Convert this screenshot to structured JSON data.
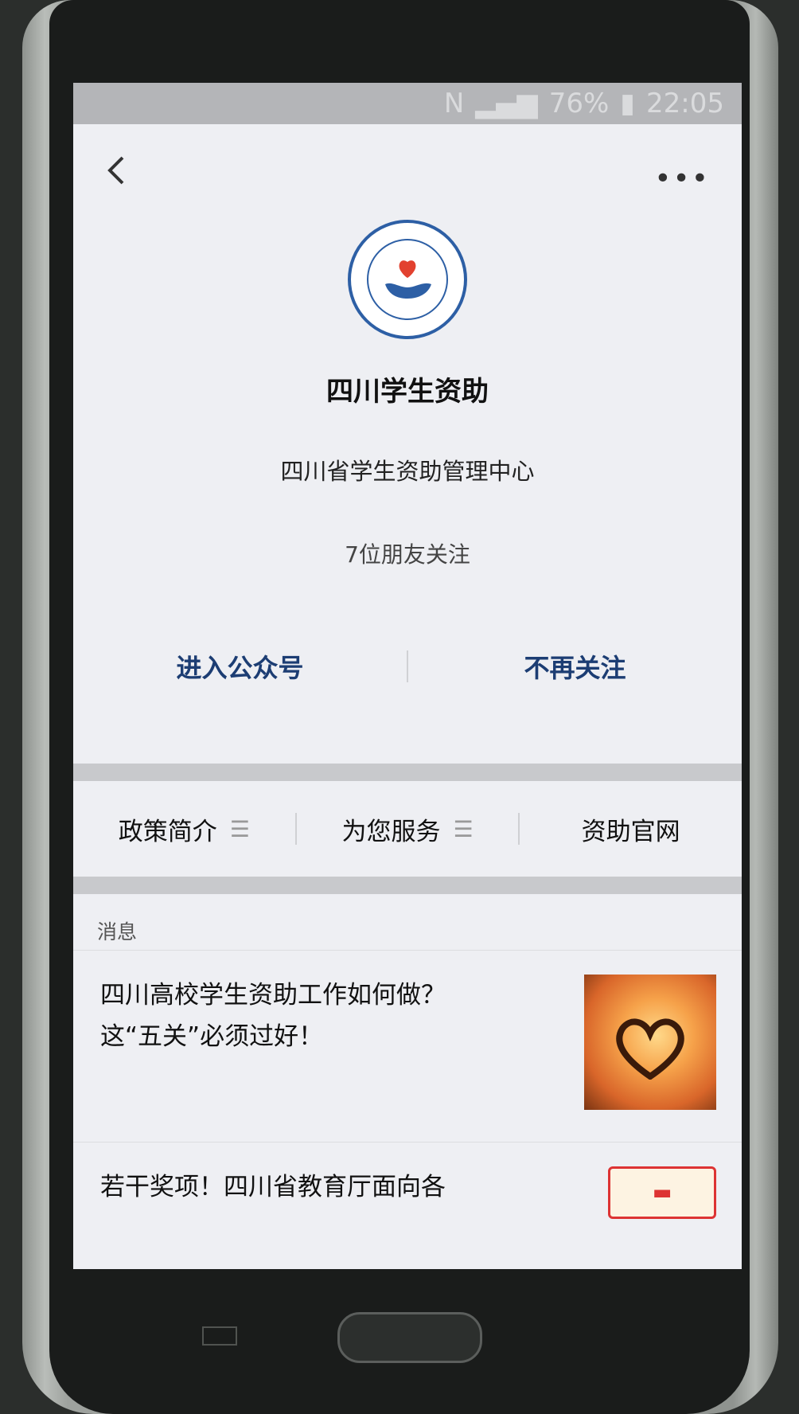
{
  "status_bar": {
    "network": "N",
    "battery": "76%",
    "time": "22:05"
  },
  "profile": {
    "account_name": "四川学生资助",
    "org_name": "四川省学生资助管理中心",
    "followers": "7位朋友关注"
  },
  "actions": {
    "enter_label": "进入公众号",
    "unfollow_label": "不再关注"
  },
  "menu": {
    "items": [
      {
        "label": "政策简介",
        "icon": "list-icon"
      },
      {
        "label": "为您服务",
        "icon": "list-icon"
      },
      {
        "label": "资助官网",
        "icon": ""
      }
    ]
  },
  "messages": {
    "header": "消息",
    "items": [
      {
        "line1": "四川高校学生资助工作如何做？",
        "line2": "这“五关”必须过好！"
      },
      {
        "line1": "若干奖项！四川省教育厅面向各",
        "line2": ""
      }
    ]
  }
}
